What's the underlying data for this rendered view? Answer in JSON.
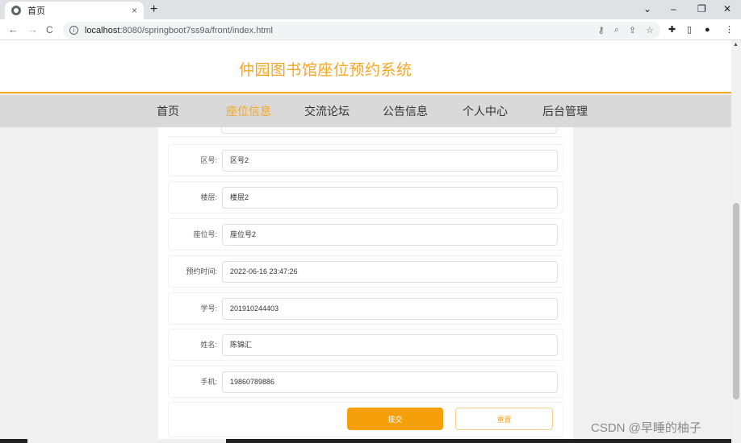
{
  "browser": {
    "tab_title": "首页",
    "tab_close": "×",
    "new_tab": "+",
    "url_host": "localhost",
    "url_path": ":8080/springboot7ss9a/front/index.html",
    "info_icon": "i",
    "back": "←",
    "forward": "→",
    "reload": "C",
    "icons": {
      "key": "⚷",
      "zoom": "⌕",
      "share": "⇪",
      "bookmark": "☆",
      "extensions": "✚",
      "sidepanel": "▯",
      "profile": "●",
      "menu": "⋮"
    },
    "window": {
      "dropdown": "⌄",
      "minimize": "–",
      "restore": "❐",
      "close": "✕"
    }
  },
  "site": {
    "title": "仲园图书馆座位预约系统",
    "accent": "#f5a623",
    "nav": [
      {
        "label": "首页"
      },
      {
        "label": "座位信息",
        "active": true
      },
      {
        "label": "交流论坛"
      },
      {
        "label": "公告信息"
      },
      {
        "label": "个人中心"
      },
      {
        "label": "后台管理"
      }
    ]
  },
  "form": {
    "fields": [
      {
        "label": "区号:",
        "value": "区号2"
      },
      {
        "label": "楼层:",
        "value": "楼层2"
      },
      {
        "label": "座位号:",
        "value": "座位号2"
      },
      {
        "label": "预约时间:",
        "value": "2022-06-16 23:47:26"
      },
      {
        "label": "学号:",
        "value": "201910244403"
      },
      {
        "label": "姓名:",
        "value": "陈锦汇"
      },
      {
        "label": "手机:",
        "value": "19860789886"
      }
    ],
    "submit_label": "提交",
    "reset_label": "重置"
  },
  "watermark": "CSDN @早睡的柚子"
}
